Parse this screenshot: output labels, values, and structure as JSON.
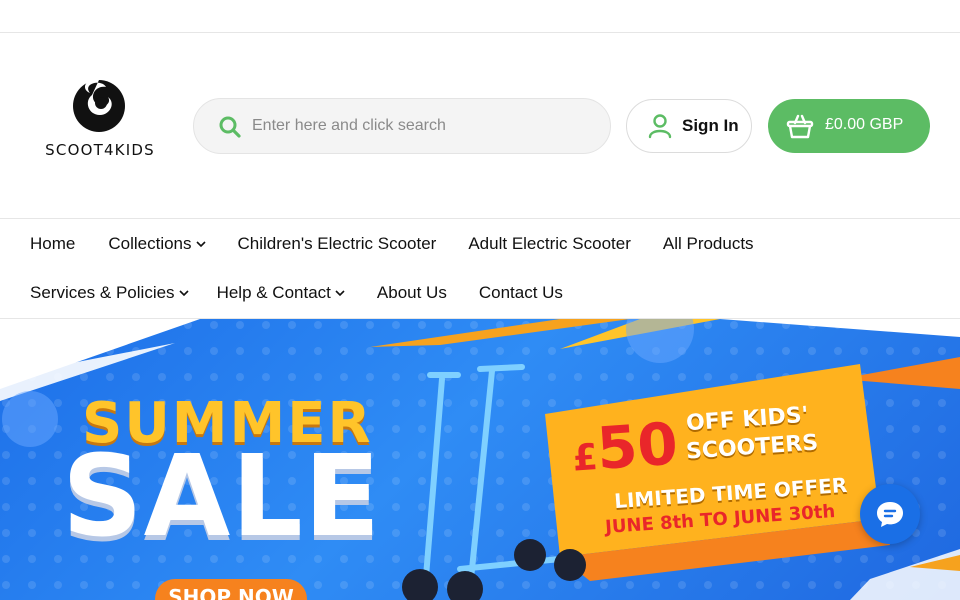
{
  "header": {
    "logo_text": "SCOOT4KIDS",
    "search": {
      "placeholder": "Enter here and click search",
      "icon": "search-icon"
    },
    "signin": {
      "label": "Sign In",
      "icon": "user-icon"
    },
    "cart": {
      "label": "£0.00 GBP",
      "icon": "basket-icon"
    }
  },
  "nav": {
    "row1": [
      {
        "label": "Home",
        "dropdown": false
      },
      {
        "label": "Collections",
        "dropdown": true
      },
      {
        "label": "Children's Electric Scooter",
        "dropdown": false
      },
      {
        "label": "Adult Electric Scooter",
        "dropdown": false
      },
      {
        "label": "All Products",
        "dropdown": false
      }
    ],
    "row2": [
      {
        "label": "Services & Policies",
        "dropdown": true
      },
      {
        "label": "Help & Contact",
        "dropdown": true
      },
      {
        "label": "About Us",
        "dropdown": false
      },
      {
        "label": "Contact Us",
        "dropdown": false
      }
    ]
  },
  "banner": {
    "headline_1": "SUMMER",
    "headline_2": "SALE",
    "cta": "SHOP NOW",
    "offer_amount": "50",
    "offer_currency": "£",
    "offer_line_1": "OFF KIDS'",
    "offer_line_2": "SCOOTERS",
    "offer_line_3": "LIMITED TIME OFFER",
    "offer_dates": "JUNE 8th TO JUNE 30th"
  },
  "chat": {
    "icon": "chat-icon"
  },
  "colors": {
    "accent_green": "#5cbc64",
    "banner_blue": "#2f8cf5",
    "offer_yellow": "#ffc42a",
    "offer_red": "#e9262a",
    "cta_orange": "#f6821e"
  }
}
